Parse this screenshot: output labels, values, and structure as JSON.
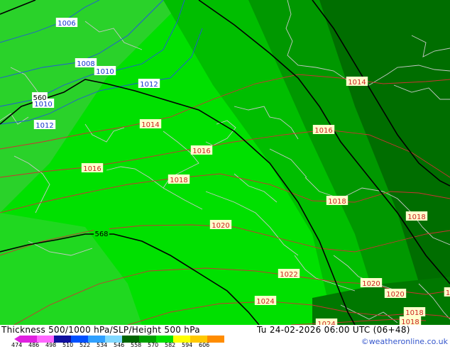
{
  "map": {
    "colors": {
      "field_light": "#2ad22a",
      "field_bright": "#00e000",
      "field_mid": "#00be00",
      "field_dark": "#009800",
      "field_darkest": "#006e00",
      "coast": "#c8c8c8",
      "isobar": "#cc3333",
      "isobar_low": "#2255dd",
      "height_contour": "#000000",
      "label_fill": "#ffffcc",
      "label_fill_low": "#ffffff",
      "label_text": "#cc2222",
      "label_text_low": "#1133cc"
    },
    "isobar_labels_low": [
      "1006",
      "1008",
      "1010",
      "1012",
      "1010",
      "1012"
    ],
    "isobar_labels": [
      "1014",
      "1014",
      "1016",
      "1016",
      "1016",
      "1018",
      "1018",
      "1018",
      "1020",
      "1020",
      "1020",
      "1022",
      "1024",
      "1024",
      "1018",
      "1018",
      "1"
    ],
    "height_labels": [
      "560",
      "568"
    ]
  },
  "footer": {
    "title": "Thickness 500/1000 hPa/SLP/Height 500 hPa",
    "datetime": "Tu 24-02-2026 06:00 UTC (06+48)",
    "legend_ticks": [
      "474",
      "486",
      "498",
      "510",
      "522",
      "534",
      "546",
      "558",
      "570",
      "582",
      "594",
      "606"
    ],
    "legend_colors": [
      "#e020e0",
      "#ff66ff",
      "#1010a0",
      "#0050ff",
      "#30a0ff",
      "#80d8ff",
      "#006400",
      "#00a000",
      "#00e000",
      "#ffff00",
      "#ffc800",
      "#ff8c00"
    ],
    "copyright": "©weatheronline.co.uk"
  }
}
